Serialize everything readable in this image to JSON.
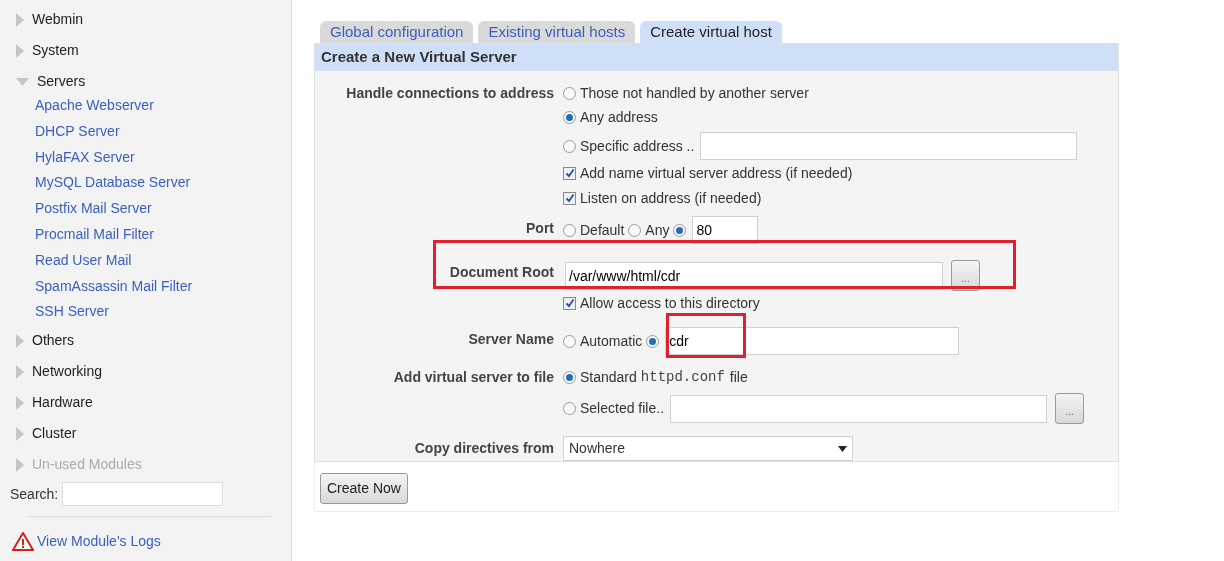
{
  "sidebar": {
    "categories": [
      {
        "label": "Webmin",
        "expanded": false,
        "disabled": false
      },
      {
        "label": "System",
        "expanded": false,
        "disabled": false
      },
      {
        "label": "Servers",
        "expanded": true,
        "disabled": false,
        "children": [
          {
            "label": "Apache Webserver"
          },
          {
            "label": "DHCP Server"
          },
          {
            "label": "HylaFAX Server"
          },
          {
            "label": "MySQL Database Server"
          },
          {
            "label": "Postfix Mail Server"
          },
          {
            "label": "Procmail Mail Filter"
          },
          {
            "label": "Read User Mail"
          },
          {
            "label": "SpamAssassin Mail Filter"
          },
          {
            "label": "SSH Server"
          }
        ]
      },
      {
        "label": "Others",
        "expanded": false,
        "disabled": false
      },
      {
        "label": "Networking",
        "expanded": false,
        "disabled": false
      },
      {
        "label": "Hardware",
        "expanded": false,
        "disabled": false
      },
      {
        "label": "Cluster",
        "expanded": false,
        "disabled": false
      },
      {
        "label": "Un-used Modules",
        "expanded": false,
        "disabled": true
      }
    ],
    "search": {
      "label": "Search:"
    },
    "logs_link": {
      "label": "View Module's Logs"
    }
  },
  "tabs": [
    {
      "label": "Global configuration",
      "selected": false
    },
    {
      "label": "Existing virtual hosts",
      "selected": false
    },
    {
      "label": "Create virtual host",
      "selected": true
    }
  ],
  "form": {
    "title": "Create a New Virtual Server",
    "lines": [
      {
        "label": "Handle connections to address",
        "items": [
          {
            "kind": "radio",
            "label": "Those not handled by another server",
            "selected": false
          }
        ]
      },
      {
        "items": [
          {
            "kind": "radio",
            "label": "Any address",
            "selected": true
          }
        ]
      },
      {
        "items": [
          {
            "kind": "radio",
            "label": "Specific address ..",
            "selected": false
          },
          {
            "kind": "text"
          }
        ]
      },
      {
        "items": [
          {
            "kind": "checkbox",
            "label": "Add name virtual server address (if needed)",
            "checked": true
          }
        ]
      },
      {
        "items": [
          {
            "kind": "checkbox",
            "label": "Listen on address (if needed)",
            "checked": true
          }
        ]
      },
      {
        "label": "Port",
        "items": [
          {
            "kind": "radio",
            "label": "Default",
            "selected": false
          },
          {
            "kind": "radio",
            "label": "Any",
            "selected": false
          },
          {
            "kind": "radio",
            "selected": true
          },
          {
            "kind": "text",
            "value": "80"
          }
        ]
      },
      {
        "label": "Document Root",
        "items": [
          {
            "kind": "text",
            "value": "/var/www/html/cdr"
          },
          {
            "kind": "browse",
            "label": "..."
          }
        ]
      },
      {
        "items": [
          {
            "kind": "checkbox",
            "label": "Allow access to this directory",
            "checked": true
          }
        ]
      },
      {
        "label": "Server Name",
        "items": [
          {
            "kind": "radio",
            "label": "Automatic",
            "selected": false
          },
          {
            "kind": "radio",
            "selected": true
          },
          {
            "kind": "text",
            "value": "cdr"
          }
        ]
      },
      {
        "label": "Add virtual server to file",
        "items": [
          {
            "kind": "radio",
            "label": "Standard",
            "selected": true
          },
          {
            "kind": "code",
            "label": "httpd.conf"
          },
          {
            "kind": "plain",
            "label": "file"
          }
        ]
      },
      {
        "items": [
          {
            "kind": "radio",
            "label": "Selected file..",
            "selected": false
          },
          {
            "kind": "text"
          },
          {
            "kind": "browse",
            "label": "..."
          }
        ]
      },
      {
        "label": "Copy directives from",
        "items": [
          {
            "kind": "select",
            "value": "Nowhere"
          }
        ]
      }
    ],
    "submit": "Create Now"
  }
}
